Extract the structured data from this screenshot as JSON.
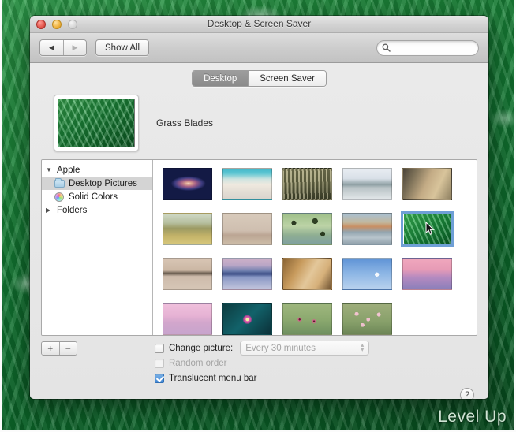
{
  "window": {
    "title": "Desktop & Screen Saver",
    "traffic_lights": [
      "close-button",
      "minimize-button",
      "zoom-button"
    ]
  },
  "toolbar": {
    "back_label": "◀",
    "forward_label": "▶",
    "show_all_label": "Show All",
    "search": {
      "value": "",
      "placeholder": "",
      "icon": "search-icon"
    }
  },
  "tabs": [
    {
      "label": "Desktop",
      "selected": true
    },
    {
      "label": "Screen Saver",
      "selected": false
    }
  ],
  "preview": {
    "label": "Grass Blades",
    "image": "grass-blades"
  },
  "sidebar": {
    "items": [
      {
        "label": "Apple",
        "type": "group",
        "expanded": true,
        "disclosure": "▼",
        "icon": null,
        "selected": false
      },
      {
        "label": "Desktop Pictures",
        "type": "child",
        "icon": "folder-icon",
        "selected": true
      },
      {
        "label": "Solid Colors",
        "type": "child",
        "icon": "color-wheel-icon",
        "selected": false
      },
      {
        "label": "Folders",
        "type": "group",
        "expanded": false,
        "disclosure": "▶",
        "icon": null,
        "selected": false
      }
    ]
  },
  "thumbnails": [
    {
      "name": "andromeda-galaxy",
      "selected": false,
      "css": "radial-gradient(ellipse 26px 11px at 52% 48%, #f2d3c0 0%, #d89c8e 16%, #a05c86 38%, #3f3d82 65%, #131a45 85%), linear-gradient(160deg,#0b1030,#141a4a 55%,#070b22)"
    },
    {
      "name": "beach-shore",
      "selected": false,
      "css": "linear-gradient(to bottom, #3fb7c9 0%, #63c8d3 16%, #cfe4e0 34%, #efe9df 52%, #e4ded5 74%, #d9d4cc 100%)"
    },
    {
      "name": "wheat-grass",
      "selected": false,
      "css": "repeating-linear-gradient(88deg, rgba(220,214,180,.55) 0 2px, rgba(60,62,40,.5) 2px 5px), linear-gradient(to bottom,#8e8c66,#6d6e4c 50%,#2f3322)"
    },
    {
      "name": "misty-lake",
      "selected": false,
      "css": "linear-gradient(to bottom,#e8edf2 0%,#d9e0e8 32%,#8fa0a4 52%,#b9c3c6 62%,#e3e8ea 100%)"
    },
    {
      "name": "sand-dune-bird",
      "selected": false,
      "css": "linear-gradient(115deg,#4b4438 0%,#7d7158 22%,#c3ab85 48%,#d8c49b 70%,#8d7f60 100%)"
    },
    {
      "name": "elephant-savanna",
      "selected": false,
      "css": "linear-gradient(to bottom,#cfd9c6 0%,#b6bf9f 30%,#9b9a63 48%,#c2b268 72%,#d8c87c 100%)"
    },
    {
      "name": "desert-herd",
      "selected": false,
      "css": "linear-gradient(to bottom,#d8cabb 0%,#cfbfb0 55%,#bba593 70%,#cdbda9 100%)"
    },
    {
      "name": "lily-pads",
      "selected": false,
      "css": "radial-gradient(circle 5px at 22% 30%, #2c3a22 0 60%, transparent 61%), radial-gradient(circle 6px at 66% 24%, #2f4024 0 60%, transparent 61%), radial-gradient(circle 5px at 82% 66%, #2a3a20 0 60%, transparent 61%), linear-gradient(to bottom,#9fc08a,#bcd3a6 40%,#8fae92 70%,#7fa0a0)"
    },
    {
      "name": "colorful-landscape",
      "selected": false,
      "css": "linear-gradient(to bottom,#a9c0d2 0%,#c2b89e 28%,#c98f63 42%,#93a5b0 60%,#b8c4cc 78%,#8fa0aa 100%)"
    },
    {
      "name": "grass-blades",
      "selected": true,
      "css": "repeating-linear-gradient(66deg, rgba(255,255,255,.25) 0 2px, rgba(0,0,0,.16) 2px 6px), linear-gradient(150deg,#3dba57,#1e9440 45%,#0f7430 80%,#0a5c24)"
    },
    {
      "name": "island-reflection",
      "selected": false,
      "css": "linear-gradient(to bottom,#d8c5b4 0%,#cbb7a4 38%,#6a5d50 48%,#cdbbab 58%,#d6c6b6 100%)"
    },
    {
      "name": "lake-sunset",
      "selected": false,
      "css": "linear-gradient(to bottom,#cdb0c8 0%,#b9a6c6 22%,#6f7fae 40%,#3c4e86 50%,#8897c4 60%,#c3c6dd 100%)"
    },
    {
      "name": "lion-portrait",
      "selected": false,
      "css": "linear-gradient(120deg,#8a6434 0%,#c79a5c 30%,#e3c79a 55%,#d6b07a 75%,#6d5130 100%)"
    },
    {
      "name": "moon-blue-sky",
      "selected": false,
      "css": "radial-gradient(circle 5px at 70% 52%, rgba(255,255,255,.92) 0 50%, transparent 55%), linear-gradient(to bottom,#5f93d6,#8ab4e4 45%,#b9d2ee 100%)"
    },
    {
      "name": "pink-mountain",
      "selected": false,
      "css": "linear-gradient(to bottom,#f0a7bd 0%,#e79bb6 35%,#b48ac0 62%,#8a7fba 100%)"
    },
    {
      "name": "pink-fog-city",
      "selected": false,
      "css": "linear-gradient(to bottom,#f0c0dc 0%,#e6b2d4 40%,#d2a6cc 62%,#c7a4cd 100%)"
    },
    {
      "name": "lotus-flower",
      "selected": false,
      "css": "radial-gradient(circle 10px at 50% 52%, #f5efa8 0 18%, #e069b0 22%, #c0459b 45%, transparent 60%), linear-gradient(135deg,#0d3b3f,#12626a 50%,#0b3038)"
    },
    {
      "name": "pink-poppies",
      "selected": false,
      "css": "radial-gradient(circle 7px at 34% 52%, #5a2030 0 14%, #e0568f 20%, transparent 45%), radial-gradient(circle 7px at 64% 58%, #5a2030 0 14%, #e0568f 20%, transparent 45%), linear-gradient(to bottom,#9fb77e,#8aa86e 55%,#6f9060)"
    },
    {
      "name": "cherry-blossoms",
      "selected": false,
      "css": "radial-gradient(circle 4px at 28% 34%, #f2c3cf 0 60%, transparent 62%), radial-gradient(circle 4px at 52% 52%, #eebfcc 0 60%, transparent 62%), radial-gradient(circle 4px at 74% 36%, #f2c5d2 0 60%, transparent 62%), radial-gradient(circle 4px at 40% 70%, #eec0cd 0 60%, transparent 62%), linear-gradient(to bottom,#9fae7c,#87a06a 60%,#6c8556)"
    }
  ],
  "bottom": {
    "add_label": "+",
    "remove_label": "−",
    "change_picture": {
      "label": "Change picture:",
      "checked": false
    },
    "interval": {
      "value": "Every 30 minutes",
      "enabled": false,
      "stepper_up": "▴",
      "stepper_down": "▾"
    },
    "random_order": {
      "label": "Random order",
      "checked": false,
      "enabled": false
    },
    "translucent_menu_bar": {
      "label": "Translucent menu bar",
      "checked": true
    },
    "help_label": "?"
  },
  "desktop": {
    "watermark": "Level Up",
    "wallpaper": "grass-blades"
  },
  "colors": {
    "selection_blue": "#6f9fd6",
    "sidebar_selection": "#d4d4d4",
    "checkbox_blue": "#3f86d4",
    "window_chrome": "#ececec"
  }
}
